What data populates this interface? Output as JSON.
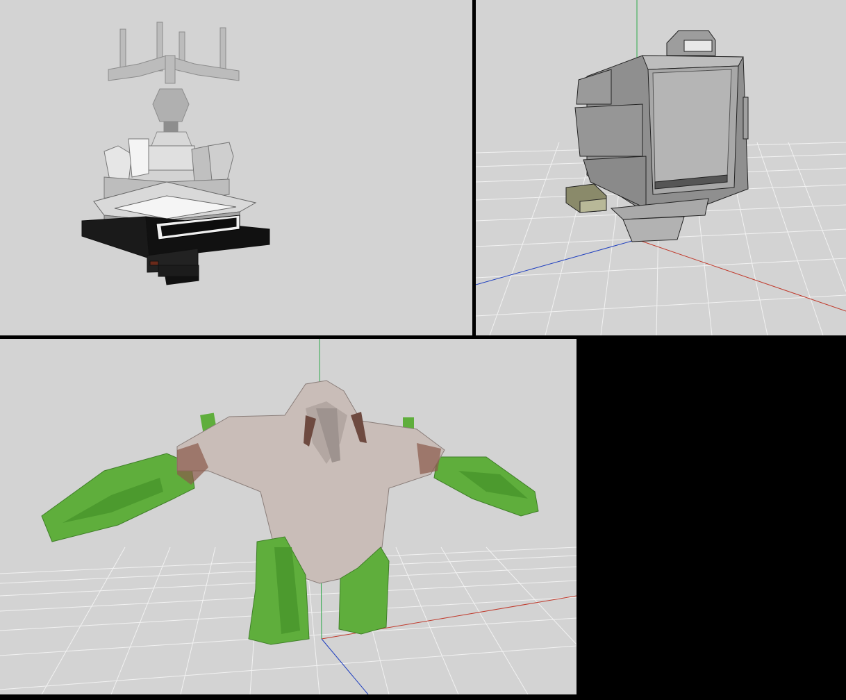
{
  "viewports": [
    {
      "id": "top-left",
      "model": "fountain-candelabra-model",
      "grid_visible": false,
      "axes_visible": false
    },
    {
      "id": "top-right",
      "model": "boxy-machine-model",
      "grid_visible": true,
      "axes_visible": true
    },
    {
      "id": "bottom-left",
      "model": "creature-model",
      "grid_visible": true,
      "axes_visible": true
    },
    {
      "id": "bottom-right",
      "empty": true
    }
  ],
  "colors": {
    "viewport_bg": "#d3d3d3",
    "grid": "#ffffff",
    "axis_x": "#c0392b",
    "axis_y": "#27ae60",
    "axis_z": "#1f3fbf",
    "border": "#000000",
    "model_gray": "#9a9a9a",
    "creature_green": "#5fae3c",
    "creature_skin": "#c9bdb8"
  }
}
